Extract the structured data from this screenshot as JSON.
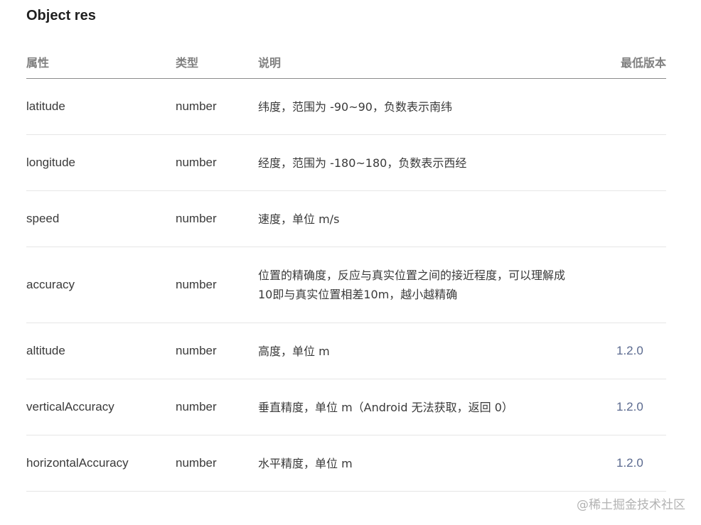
{
  "title": "Object res",
  "table": {
    "headers": [
      "属性",
      "类型",
      "说明",
      "最低版本"
    ],
    "rows": [
      {
        "name": "latitude",
        "type": "number",
        "desc": "纬度，范围为 -90~90，负数表示南纬",
        "version": ""
      },
      {
        "name": "longitude",
        "type": "number",
        "desc": "经度，范围为 -180~180，负数表示西经",
        "version": ""
      },
      {
        "name": "speed",
        "type": "number",
        "desc": "速度，单位 m/s",
        "version": ""
      },
      {
        "name": "accuracy",
        "type": "number",
        "desc": "位置的精确度，反应与真实位置之间的接近程度，可以理解成10即与真实位置相差10m，越小越精确",
        "version": ""
      },
      {
        "name": "altitude",
        "type": "number",
        "desc": "高度，单位 m",
        "version": "1.2.0"
      },
      {
        "name": "verticalAccuracy",
        "type": "number",
        "desc": "垂直精度，单位 m（Android 无法获取，返回 0）",
        "version": "1.2.0"
      },
      {
        "name": "horizontalAccuracy",
        "type": "number",
        "desc": "水平精度，单位 m",
        "version": "1.2.0"
      }
    ]
  },
  "watermark": "@稀土掘金技术社区"
}
